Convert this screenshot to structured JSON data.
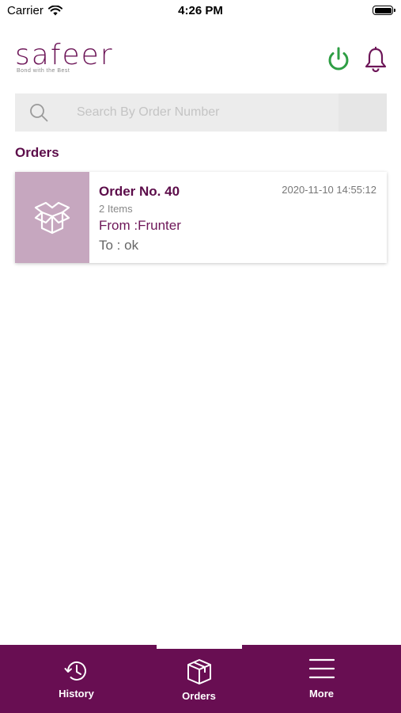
{
  "status_bar": {
    "carrier": "Carrier",
    "time": "4:26 PM"
  },
  "header": {
    "logo_text": "safeer",
    "logo_tagline": "Bond with the Best",
    "power_icon": "power-icon",
    "bell_icon": "bell-icon",
    "power_color": "#2e9e44",
    "brand_color": "#6d1658"
  },
  "search": {
    "placeholder": "Search By Order Number",
    "value": ""
  },
  "orders_section": {
    "title": "Orders",
    "orders": [
      {
        "number": "Order No. 40",
        "date": "2020-11-10 14:55:12",
        "items": "2 Items",
        "from": "From :Frunter",
        "to": "To : ok",
        "icon": "box-icon"
      }
    ]
  },
  "tab_bar": {
    "active": "Orders",
    "tabs": [
      {
        "label": "History",
        "icon": "history-icon"
      },
      {
        "label": "Orders",
        "icon": "box-icon"
      },
      {
        "label": "More",
        "icon": "menu-icon"
      }
    ]
  }
}
